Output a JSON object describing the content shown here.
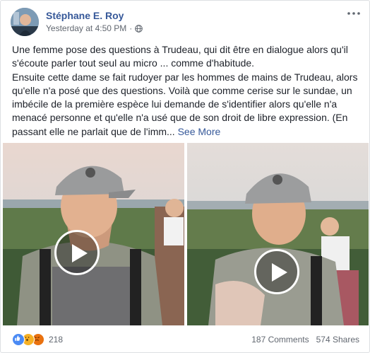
{
  "post": {
    "author": "Stéphane E. Roy",
    "timestamp": "Yesterday at 4:50 PM",
    "separator": "·",
    "privacy_icon": "globe-icon",
    "more_icon": "more-options-icon",
    "text_p1": "Une femme pose des questions à Trudeau, qui dit être en dialogue alors qu'il s'écoute parler tout seul au micro ... comme d'habitude.",
    "text_p2": "Ensuite cette dame se fait rudoyer par les hommes de mains de Trudeau, alors qu'elle n'a posé que des questions. Voilà que comme cerise sur le sundae, un imbécile de la première espèce lui demande de s'identifier alors qu'elle n'a menacé personne et qu'elle n'a usé que de son droit de libre expression. (En passant elle ne parlait que de l'imm...",
    "see_more": "See More"
  },
  "media": {
    "play_icon": "play-icon"
  },
  "footer": {
    "reactions": [
      "like",
      "wow",
      "angry"
    ],
    "reaction_count": "218",
    "comments": "187 Comments",
    "shares": "574 Shares"
  },
  "colors": {
    "link": "#365899",
    "text": "#1d2129",
    "meta": "#616770"
  }
}
